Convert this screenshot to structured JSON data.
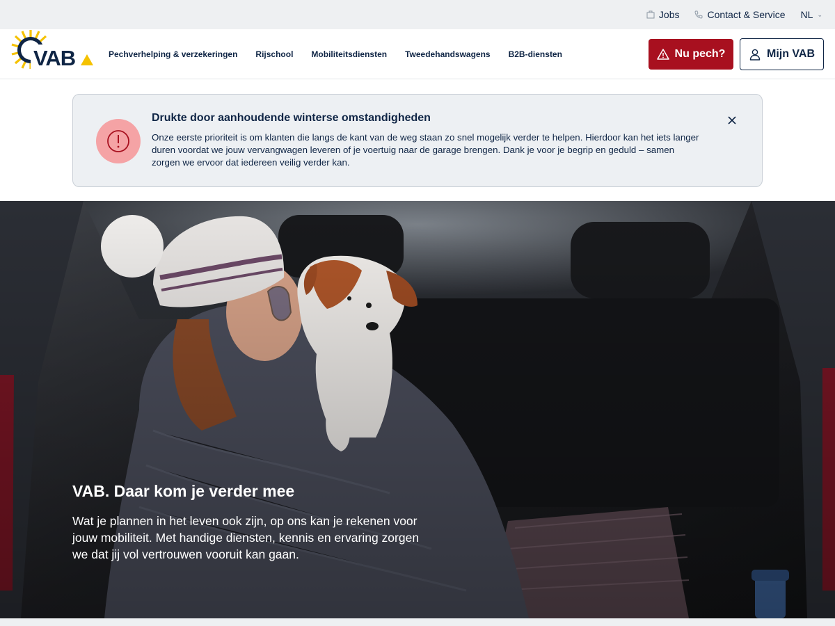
{
  "utility": {
    "jobs_label": "Jobs",
    "contact_label": "Contact & Service",
    "language": "NL"
  },
  "header": {
    "logo_text": "VAB",
    "nav": [
      {
        "label": "Pechverhelping & verzekeringen"
      },
      {
        "label": "Rijschool"
      },
      {
        "label": "Mobiliteitsdiensten"
      },
      {
        "label": "Tweedehandswagens"
      },
      {
        "label": "B2B-diensten"
      }
    ],
    "pech_button": "Nu pech?",
    "account_button": "Mijn VAB"
  },
  "alert": {
    "title": "Drukte door aanhoudende winterse omstandigheden",
    "text": "Onze eerste prioriteit is om klanten die langs de kant van de weg staan zo snel mogelijk verder te helpen. Hierdoor kan het iets langer duren voordat we jouw vervangwagen leveren of je voertuig naar de garage brengen. Dank je voor je begrip en geduld – samen zorgen we ervoor dat iedereen veilig verder kan."
  },
  "hero": {
    "title": "VAB. Daar kom je verder mee",
    "text": "Wat je plannen in het leven ook zijn, op ons kan je rekenen voor jouw mobiliteit. Met handige diensten, kennis en ervaring zorgen we dat jij vol vertrouwen vooruit kan gaan."
  },
  "colors": {
    "brand_navy": "#0f2545",
    "brand_yellow": "#f5c200",
    "alert_red": "#a8101f",
    "alert_icon_bg": "#f5a3a5"
  },
  "icons": {
    "jobs": "briefcase-icon",
    "contact": "phone-icon",
    "pech": "warning-triangle-icon",
    "account": "user-icon",
    "alert": "exclamation-circle-icon",
    "close": "close-icon"
  }
}
